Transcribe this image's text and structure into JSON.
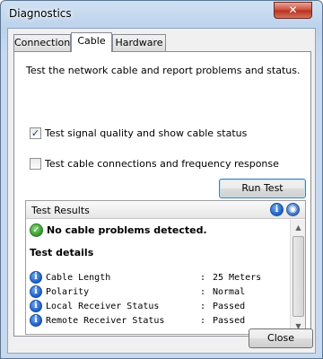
{
  "window": {
    "title": "Diagnostics",
    "close_glyph": "✕"
  },
  "tabs": [
    {
      "label": "Connection",
      "active": false
    },
    {
      "label": "Cable",
      "active": true
    },
    {
      "label": "Hardware",
      "active": false
    }
  ],
  "cable_tab": {
    "description": "Test the network cable and report problems and status.",
    "options": [
      {
        "label": "Test signal quality and show cable status",
        "checked": true
      },
      {
        "label": "Test cable connections and frequency response",
        "checked": false
      }
    ],
    "run_button": "Run Test"
  },
  "results": {
    "header": "Test Results",
    "summary": "No cable problems detected.",
    "details_title": "Test details",
    "details": [
      {
        "name": "Cable Length",
        "value": "25 Meters"
      },
      {
        "name": "Polarity",
        "value": "Normal"
      },
      {
        "name": "Local Receiver Status",
        "value": "Passed"
      },
      {
        "name": "Remote Receiver Status",
        "value": "Passed"
      }
    ],
    "separator": ":"
  },
  "footer": {
    "close_button": "Close"
  },
  "icons": {
    "check": "check-circle-icon",
    "info": "info-icon",
    "info_glyph": "i",
    "check_glyph": "✓"
  },
  "colors": {
    "titlebar": "#bdd3ec",
    "close": "#c94a37",
    "info": "#1d5ec4",
    "ok": "#2f9a2a"
  }
}
